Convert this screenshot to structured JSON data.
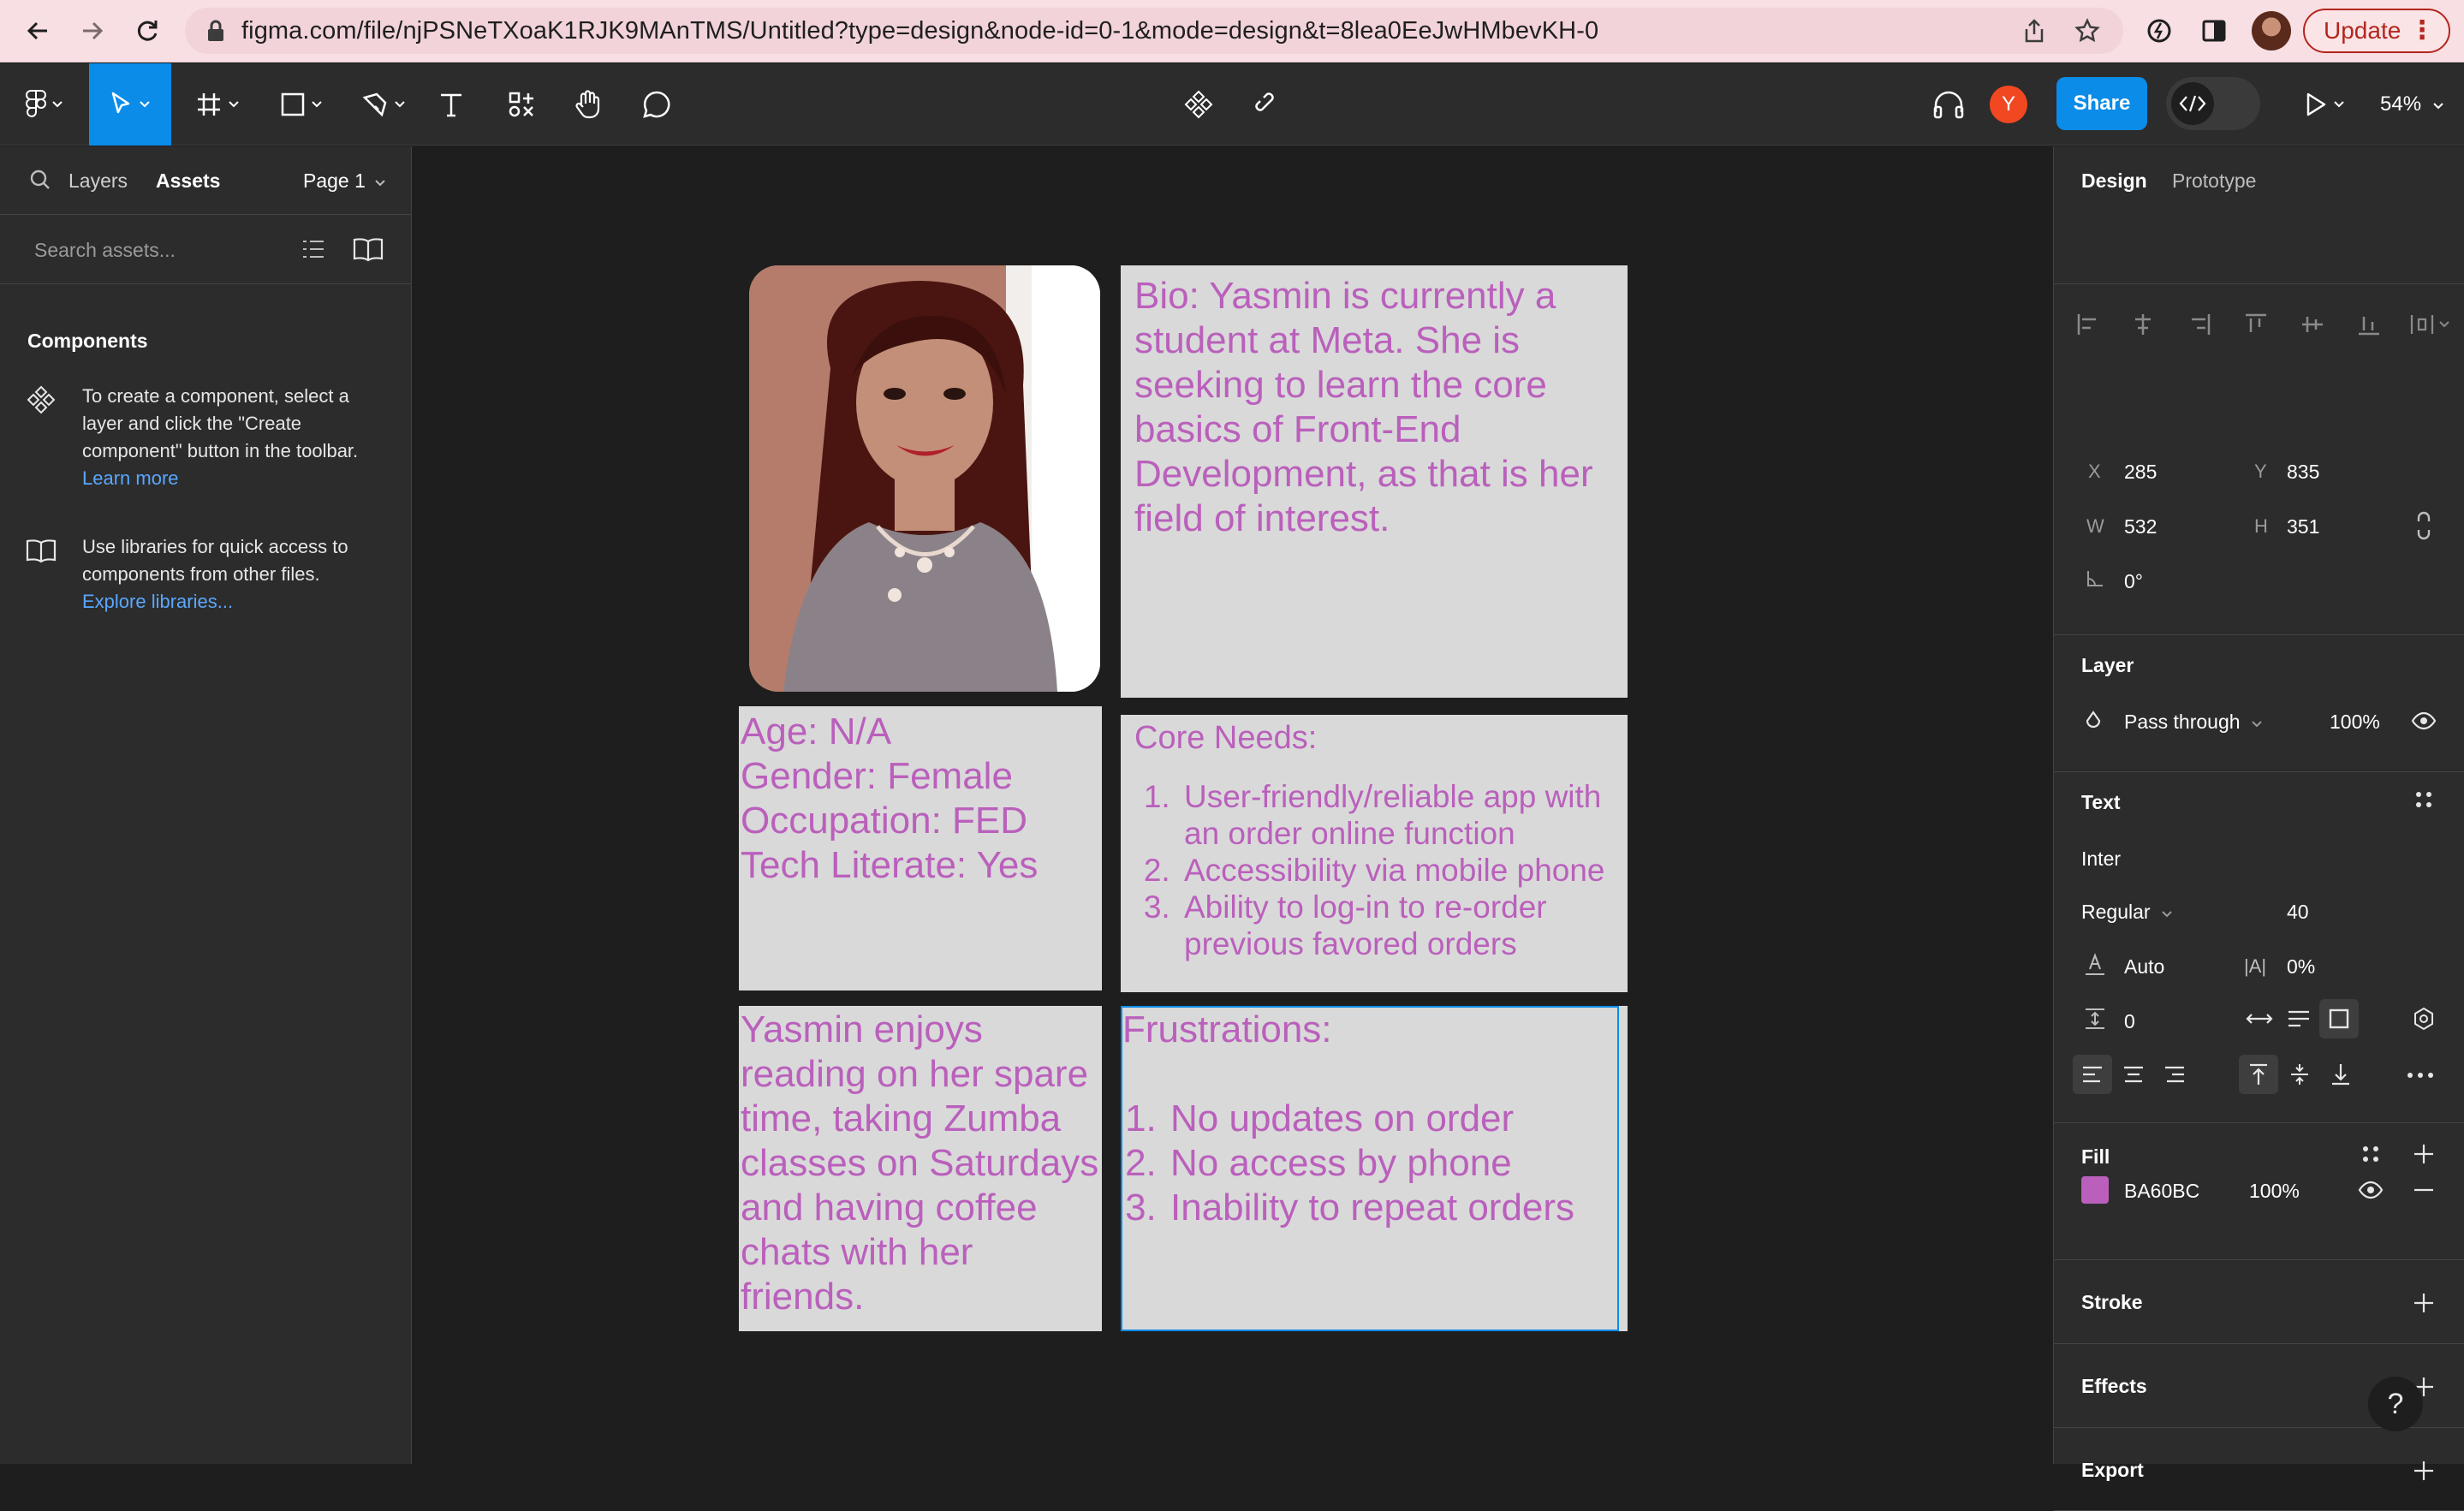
{
  "browser": {
    "url": "figma.com/file/njPSNeTXoaK1RJK9MAnTMS/Untitled?type=design&node-id=0-1&mode=design&t=8lea0EeJwHMbevKH-0",
    "update_label": "Update"
  },
  "toolbar": {
    "share_label": "Share",
    "user_initial": "Y",
    "zoom": "54%"
  },
  "left_panel": {
    "tabs": {
      "layers": "Layers",
      "assets": "Assets"
    },
    "page": "Page 1",
    "search_placeholder": "Search assets...",
    "components_heading": "Components",
    "component_help": "To create a component, select a layer and click the \"Create component\" button in the toolbar.",
    "learn_more": "Learn more",
    "library_help": "Use libraries for quick access to components from other files.",
    "explore_libraries": "Explore libraries..."
  },
  "canvas": {
    "text_color": "#BA60BC",
    "card_bg": "#D9D9D9",
    "bio": "Bio: Yasmin is currently a student at Meta. She is seeking to learn the core basics of Front-End Development, as that is her field of interest.",
    "demographics": "Age: N/A\nGender: Female\nOccupation: FED\nTech Literate: Yes",
    "core_needs": {
      "title": "Core Needs:",
      "items": [
        "User-friendly/reliable app with an order online function",
        "Accessibility via mobile phone",
        "Ability to log-in to re-order previous favored orders"
      ]
    },
    "hobbies": "Yasmin enjoys reading on her spare time, taking Zumba classes on Saturdays and having coffee chats with her friends.",
    "frustrations": {
      "title": "Frustrations:",
      "items": [
        "No updates on order",
        "No access by phone",
        "Inability to repeat orders"
      ]
    }
  },
  "right_panel": {
    "tabs": {
      "design": "Design",
      "prototype": "Prototype"
    },
    "x_label": "X",
    "x_value": "285",
    "y_label": "Y",
    "y_value": "835",
    "w_label": "W",
    "w_value": "532",
    "h_label": "H",
    "h_value": "351",
    "rotation": "0°",
    "layer": {
      "title": "Layer",
      "blend": "Pass through",
      "opacity": "100%"
    },
    "text": {
      "title": "Text",
      "font": "Inter",
      "weight": "Regular",
      "size": "40",
      "line_height": "Auto",
      "letter_spacing": "0%",
      "paragraph_spacing": "0"
    },
    "fill": {
      "title": "Fill",
      "color": "#BA60BC",
      "hex": "BA60BC",
      "opacity": "100%"
    },
    "stroke_title": "Stroke",
    "effects_title": "Effects",
    "export_title": "Export",
    "help_label": "?"
  }
}
